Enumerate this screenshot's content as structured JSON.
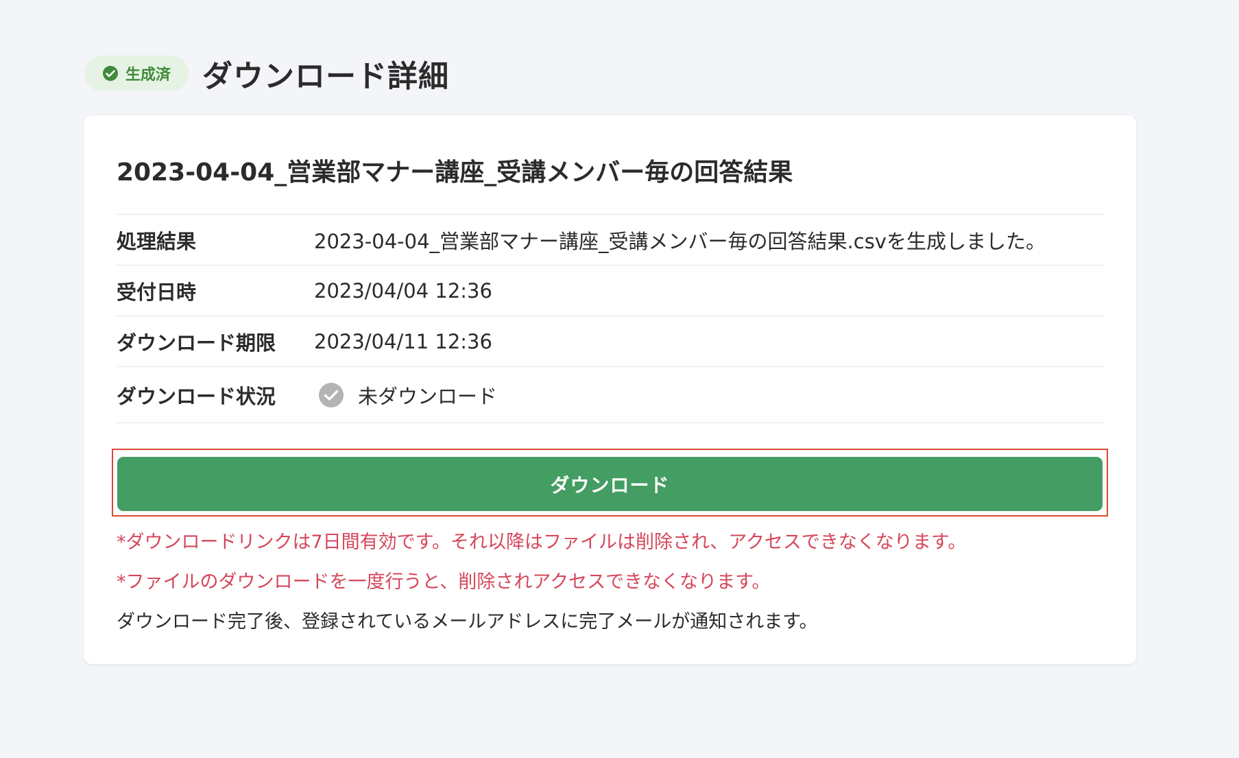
{
  "header": {
    "status_badge": "生成済",
    "page_title": "ダウンロード詳細"
  },
  "card": {
    "file_title": "2023-04-04_営業部マナー講座_受講メンバー毎の回答結果",
    "rows": [
      {
        "label": "処理結果",
        "value": "2023-04-04_営業部マナー講座_受講メンバー毎の回答結果.csvを生成しました。"
      },
      {
        "label": "受付日時",
        "value": "2023/04/04 12:36"
      },
      {
        "label": "ダウンロード期限",
        "value": "2023/04/11 12:36"
      },
      {
        "label": "ダウンロード状況",
        "value": "未ダウンロード"
      }
    ],
    "download_button": "ダウンロード",
    "notes": {
      "warn1": "*ダウンロードリンクは7日間有効です。それ以降はファイルは削除され、アクセスできなくなります。",
      "warn2": "*ファイルのダウンロードを一度行うと、削除されアクセスできなくなります。",
      "info": "ダウンロード完了後、登録されているメールアドレスに完了メールが通知されます。"
    }
  },
  "colors": {
    "background": "#f3f5f9",
    "badge_bg": "#e6f3e4",
    "badge_text": "#3f8b3a",
    "button_green": "#449d62",
    "warning_red": "#d6465a",
    "highlight_border": "#d84a2e"
  },
  "icons": {
    "badge_icon": "check-circle-icon",
    "status_icon": "check-circle-gray-icon"
  }
}
